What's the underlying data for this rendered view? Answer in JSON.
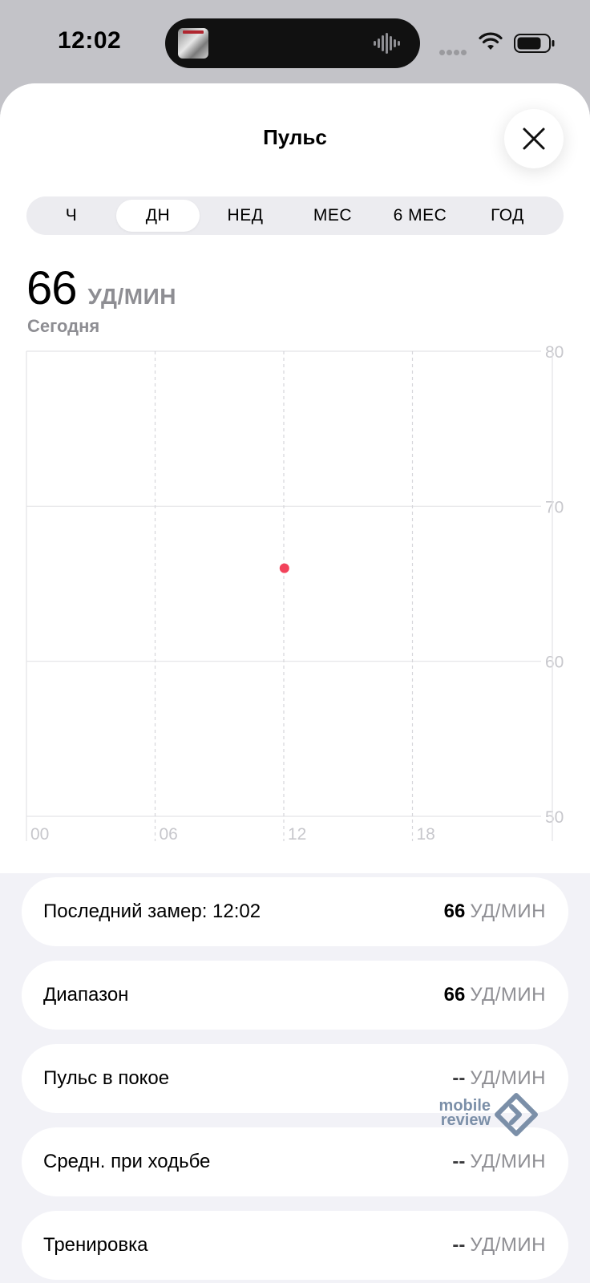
{
  "status_bar": {
    "time": "12:02"
  },
  "sheet": {
    "title": "Пульс"
  },
  "segments": [
    {
      "label": "Ч",
      "active": false
    },
    {
      "label": "ДН",
      "active": true
    },
    {
      "label": "НЕД",
      "active": false
    },
    {
      "label": "МЕС",
      "active": false
    },
    {
      "label": "6 МЕС",
      "active": false
    },
    {
      "label": "ГОД",
      "active": false
    }
  ],
  "summary": {
    "value": "66",
    "unit": "УД/МИН",
    "period": "Сегодня"
  },
  "chart_data": {
    "type": "scatter",
    "x_ticks": [
      "00",
      "06",
      "12",
      "18"
    ],
    "y_ticks": [
      "80",
      "70",
      "60",
      "50"
    ],
    "xlim": [
      0,
      24
    ],
    "ylim": [
      50,
      80
    ],
    "series": [
      {
        "points": [
          {
            "x": 12.03,
            "y": 66
          }
        ]
      }
    ],
    "colors": {
      "point": "#f2435b",
      "grid": "#e3e3e6",
      "tick_label": "#c7c7cc"
    }
  },
  "stats": [
    {
      "label": "Последний замер: 12:02",
      "value": "66",
      "unit": "УД/МИН"
    },
    {
      "label": "Диапазон",
      "value": "66",
      "unit": "УД/МИН"
    },
    {
      "label": "Пульс в покое",
      "value": "--",
      "unit": "УД/МИН"
    },
    {
      "label": "Средн. при ходьбе",
      "value": "--",
      "unit": "УД/МИН"
    },
    {
      "label": "Тренировка",
      "value": "--",
      "unit": "УД/МИН"
    }
  ],
  "watermark": {
    "line1": "mobile",
    "line2": "review"
  }
}
